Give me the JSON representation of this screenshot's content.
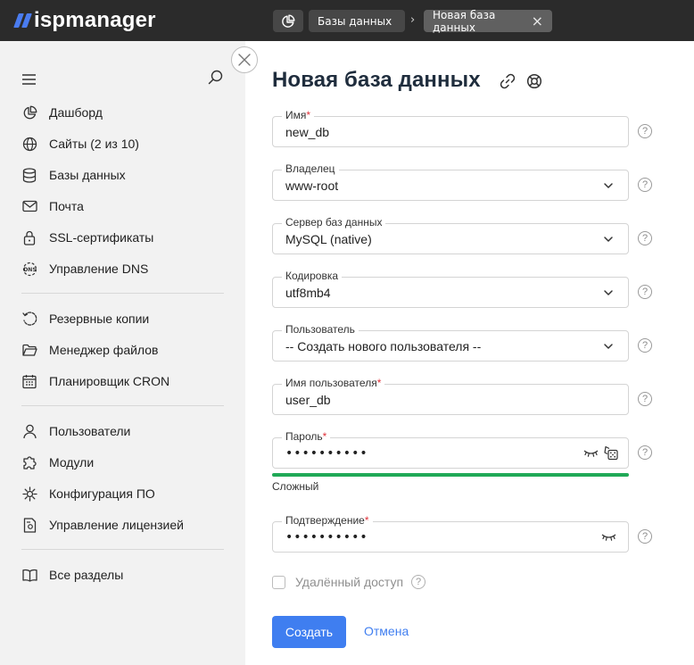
{
  "app": {
    "logo_text": "ispmanager"
  },
  "breadcrumbs": {
    "home_icon": "dashboard-pie-icon",
    "items": [
      {
        "label": "Базы данных"
      },
      {
        "label": "Новая база данных"
      }
    ],
    "separator": "›",
    "close_glyph": "×"
  },
  "sidebar": {
    "groups": [
      [
        {
          "label": "Дашборд",
          "icon": "pie-chart-icon"
        },
        {
          "label": "Сайты (2 из 10)",
          "icon": "globe-icon"
        },
        {
          "label": "Базы данных",
          "icon": "database-icon"
        },
        {
          "label": "Почта",
          "icon": "mail-icon"
        },
        {
          "label": "SSL-сертификаты",
          "icon": "lock-icon"
        },
        {
          "label": "Управление DNS",
          "icon": "dns-icon"
        }
      ],
      [
        {
          "label": "Резервные копии",
          "icon": "backup-icon"
        },
        {
          "label": "Менеджер файлов",
          "icon": "folder-icon"
        },
        {
          "label": "Планировщик CRON",
          "icon": "calendar-icon"
        }
      ],
      [
        {
          "label": "Пользователи",
          "icon": "user-icon"
        },
        {
          "label": "Модули",
          "icon": "puzzle-icon"
        },
        {
          "label": "Конфигурация ПО",
          "icon": "settings-chip-icon"
        },
        {
          "label": "Управление лицензией",
          "icon": "license-icon"
        }
      ],
      [
        {
          "label": "Все разделы",
          "icon": "book-icon"
        }
      ]
    ]
  },
  "form": {
    "title": "Новая база данных",
    "fields": {
      "name": {
        "label": "Имя",
        "required": "*",
        "value": "new_db"
      },
      "owner": {
        "label": "Владелец",
        "value": "www-root"
      },
      "server": {
        "label": "Сервер баз данных",
        "value": "MySQL (native)"
      },
      "charset": {
        "label": "Кодировка",
        "value": "utf8mb4"
      },
      "user": {
        "label": "Пользователь",
        "value": "-- Создать нового пользователя --"
      },
      "username": {
        "label": "Имя пользователя",
        "required": "*",
        "value": "user_db"
      },
      "password": {
        "label": "Пароль",
        "required": "*",
        "value": "••••••••••",
        "strength": "Сложный",
        "strength_level": 1.0
      },
      "confirm": {
        "label": "Подтверждение",
        "required": "*",
        "value": "••••••••••"
      }
    },
    "remote_access": {
      "label": "Удалённый доступ",
      "checked": false
    },
    "help_glyph": "?",
    "buttons": {
      "submit": "Создать",
      "cancel": "Отмена"
    }
  },
  "colors": {
    "accent": "#3f7ef0",
    "strength_ok": "#20a957",
    "required": "#e0323a",
    "topbar": "#2b2b2b",
    "sidebar": "#f2f2f2"
  }
}
